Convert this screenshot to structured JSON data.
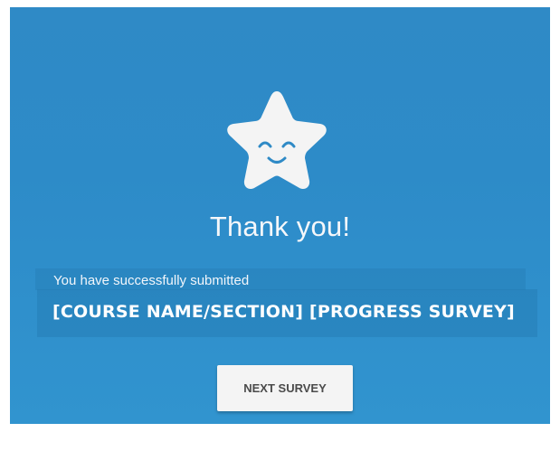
{
  "thanks": {
    "icon": "smiling-star-icon",
    "title": "Thank you!",
    "success_message": "You have successfully submitted",
    "course_label": "[COURSE NAME/SECTION] [PROGRESS SURVEY]",
    "next_button_label": "NEXT SURVEY"
  },
  "colors": {
    "background": "#2f8ac6",
    "star": "#f4f4f4",
    "face": "#2f8ac6",
    "button_bg": "#f4f4f4",
    "button_text": "#4b4b4b"
  }
}
